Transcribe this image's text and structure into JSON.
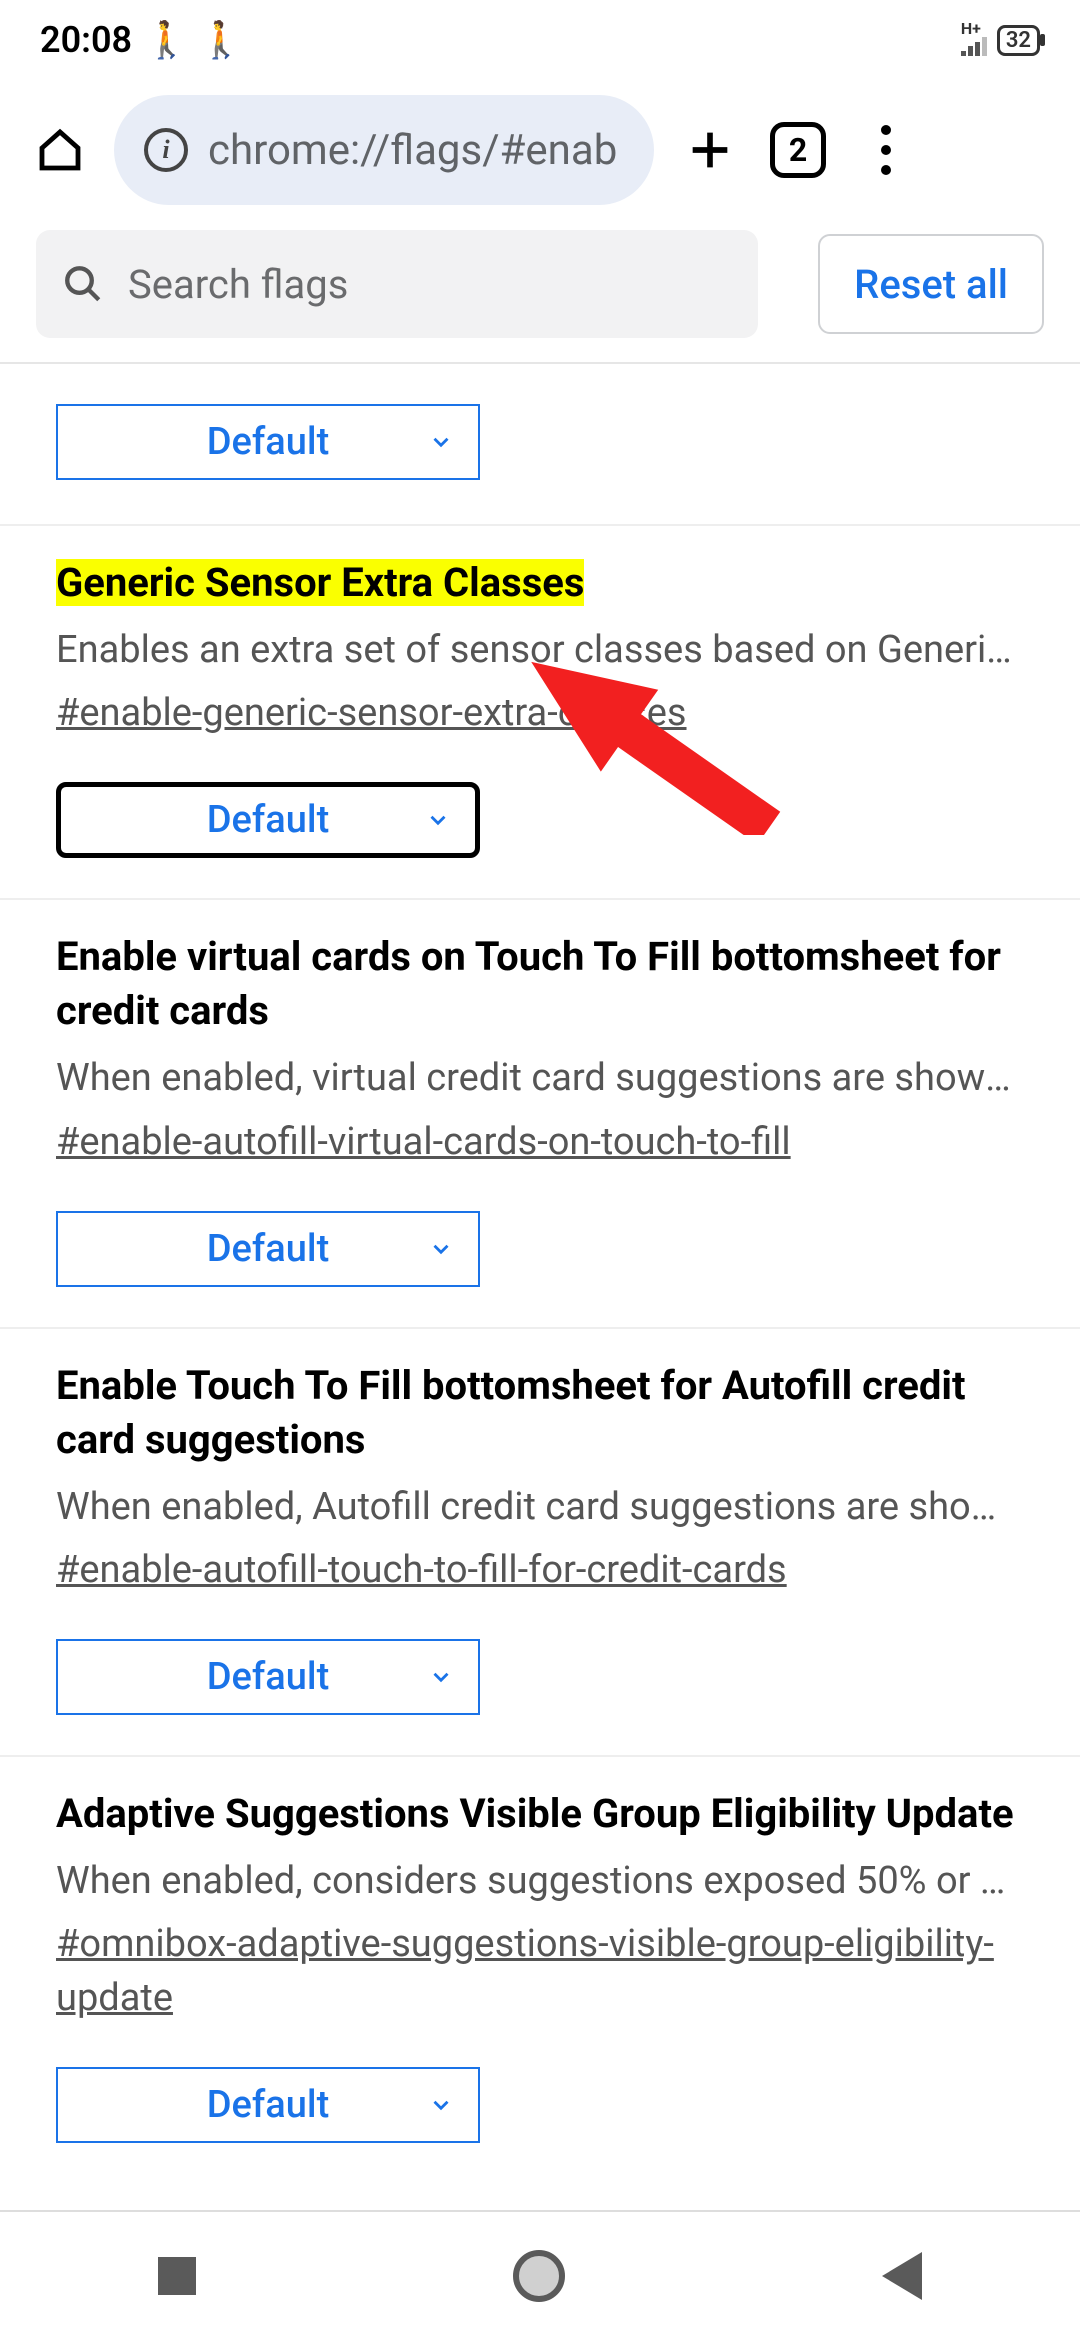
{
  "status": {
    "time": "20:08",
    "battery": "32",
    "network_label": "H+"
  },
  "browser": {
    "url": "chrome://flags/#enab",
    "tab_count": "2"
  },
  "search": {
    "placeholder": "Search flags",
    "reset_label": "Reset all"
  },
  "dropdown_default": "Default",
  "flags": [
    {
      "title": "",
      "desc": "",
      "anchor": "",
      "value": "Default",
      "highlight": false
    },
    {
      "title": "Generic Sensor Extra Classes",
      "desc": "Enables an extra set of sensor classes based on Generic S…",
      "anchor": "#enable-generic-sensor-extra-classes",
      "value": "Default",
      "highlight": true,
      "focused": true
    },
    {
      "title": "Enable virtual cards on Touch To Fill bottomsheet for credit cards",
      "desc": "When enabled, virtual credit card suggestions are shown o…",
      "anchor": "#enable-autofill-virtual-cards-on-touch-to-fill",
      "value": "Default",
      "highlight": false
    },
    {
      "title": "Enable Touch To Fill bottomsheet for Autofill credit card suggestions",
      "desc": "When enabled, Autofill credit card suggestions are shown …",
      "anchor": "#enable-autofill-touch-to-fill-for-credit-cards",
      "value": "Default",
      "highlight": false
    },
    {
      "title": "Adaptive Suggestions Visible Group Eligibility Update",
      "desc": "When enabled, considers suggestions exposed 50% or mor…",
      "anchor": "#omnibox-adaptive-suggestions-visible-group-eligibility-update",
      "value": "Default",
      "highlight": false
    }
  ]
}
